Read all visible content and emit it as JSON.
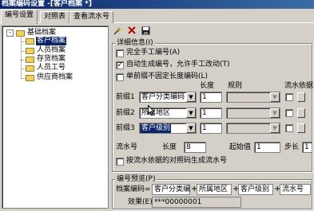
{
  "window": {
    "title": "档案编码设置 -[客户档案 *]"
  },
  "tabs": [
    {
      "label": "编号设置",
      "active": true
    },
    {
      "label": "对照表",
      "active": false
    },
    {
      "label": "查看流水号",
      "active": false
    }
  ],
  "tree": {
    "root": {
      "label": "基础档案",
      "toggle": "-"
    },
    "items": [
      {
        "label": "客户档案",
        "selected": true
      },
      {
        "label": "人员档案",
        "selected": false
      },
      {
        "label": "存货档案",
        "selected": false
      },
      {
        "label": "人员工号",
        "selected": false
      },
      {
        "label": "供应商档案",
        "selected": false
      }
    ]
  },
  "toolbar": {
    "wand_icon": "magic-wand-icon",
    "delete_icon": "delete-x-icon",
    "save_icon": "save-disk-icon"
  },
  "details": {
    "legend": "详细信息(I)",
    "options": [
      {
        "label": "完全手工编号(A)",
        "checked": false
      },
      {
        "label": "自动生成编号，允许手工改动(T)",
        "checked": true
      },
      {
        "label": "单前缀不固定长度编码(L)",
        "checked": false
      }
    ],
    "col_length": "长度",
    "col_rule": "规则",
    "col_serial_basis": "流水依据",
    "prefixes": [
      {
        "label": "前缀1",
        "value": "客户分类编码",
        "length": "1",
        "highlighted": false
      },
      {
        "label": "前缀2",
        "value": "所属地区",
        "length": "1",
        "highlighted": false
      },
      {
        "label": "前缀3",
        "value": "客户级别",
        "length": "1",
        "highlighted": true
      }
    ],
    "serial": {
      "label": "流水号",
      "length_label": "长度",
      "length": "8",
      "start_label": "起始值",
      "start": "1",
      "step_label": "步长",
      "step": "1"
    },
    "regen_label": "按流水依据的对照码生成流水号"
  },
  "preview": {
    "legend": "编号预览(P)",
    "code_label": "档案编码=",
    "parts": [
      "客户分类编",
      "所属地区",
      "客户级别",
      "流水号"
    ],
    "plus": "+",
    "effect_label": "效果(E)",
    "effect_value": "***00000001"
  },
  "colors": {
    "title_start": "#0a246a",
    "title_end": "#3a6ea5",
    "selection": "#0a246a",
    "face": "#d4d0c8"
  }
}
